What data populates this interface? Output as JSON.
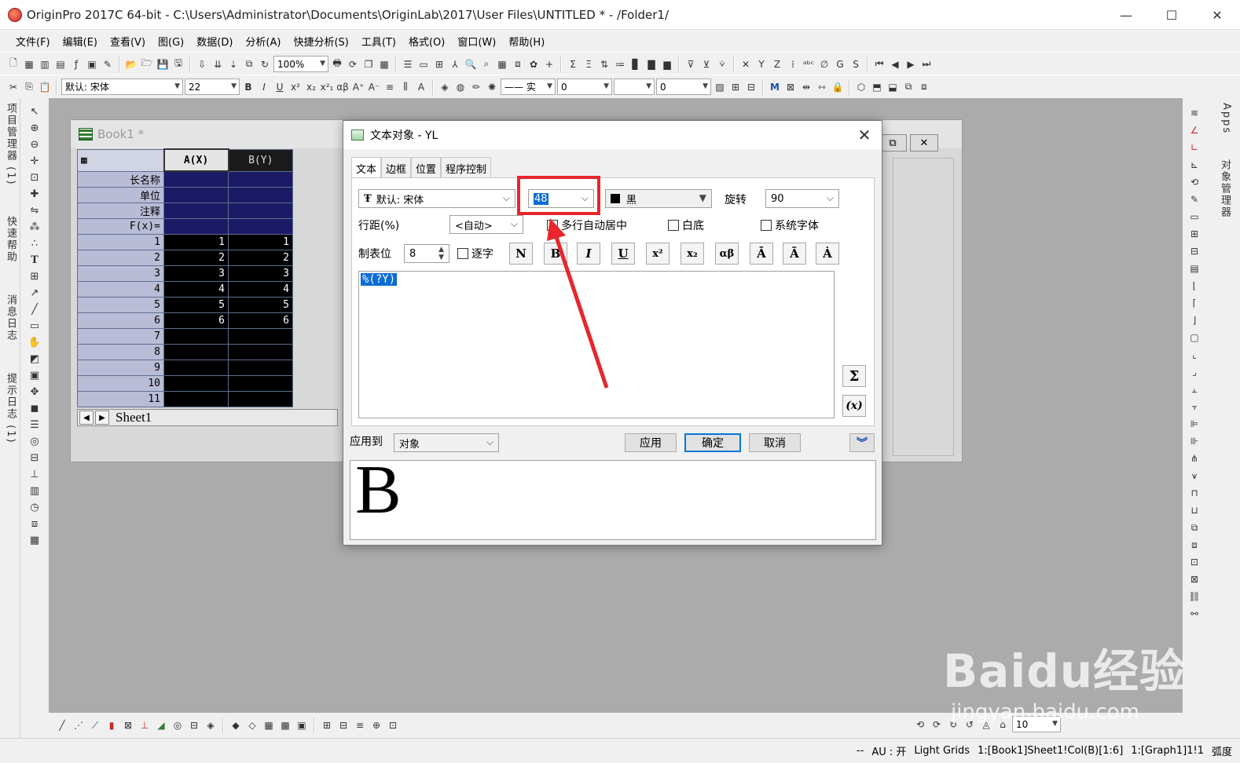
{
  "window": {
    "title": "OriginPro 2017C 64-bit - C:\\Users\\Administrator\\Documents\\OriginLab\\2017\\User Files\\UNTITLED * - /Folder1/",
    "minimize": "—",
    "maximize": "☐",
    "close": "✕"
  },
  "menu": [
    "文件(F)",
    "编辑(E)",
    "查看(V)",
    "图(G)",
    "数据(D)",
    "分析(A)",
    "快捷分析(S)",
    "工具(T)",
    "格式(O)",
    "窗口(W)",
    "帮助(H)"
  ],
  "toolbar1": {
    "zoom": "100%"
  },
  "toolbar2": {
    "font": "默认: 宋体",
    "font_size": "22",
    "line_style": "—— 实",
    "line_width": "0",
    "pattern_width": "0"
  },
  "left_dock_tabs": [
    "项目管理器 (1)",
    "快速帮助",
    "消息日志",
    "提示日志 (1)"
  ],
  "right_dock_tabs": [
    "Apps",
    "对象管理器"
  ],
  "workbook": {
    "title": "Book1 *",
    "columns": [
      {
        "label": "A(X)"
      },
      {
        "label": "B(Y)"
      }
    ],
    "meta_rows": [
      "长名称",
      "单位",
      "注释",
      "F(x)="
    ],
    "row_numbers": [
      "1",
      "2",
      "3",
      "4",
      "5",
      "6",
      "7",
      "8",
      "9",
      "10",
      "11"
    ],
    "col_a": [
      "1",
      "2",
      "3",
      "4",
      "5",
      "6",
      "",
      "",
      "",
      "",
      ""
    ],
    "col_b": [
      "1",
      "2",
      "3",
      "4",
      "5",
      "6",
      "",
      "",
      "",
      "",
      ""
    ],
    "sheet_tab": "Sheet1"
  },
  "dialog": {
    "title": "文本对象 - YL",
    "tabs": [
      "文本",
      "边框",
      "位置",
      "程序控制"
    ],
    "active_tab": "文本",
    "font": "默认: 宋体",
    "font_size": "48",
    "color": "黑",
    "rotate_label": "旋转",
    "rotate_value": "90",
    "line_spacing_label": "行距(%)",
    "line_spacing_value": "<自动>",
    "multiline_center": "多行自动居中",
    "white_bg": "白底",
    "system_font": "系统字体",
    "tab_stop_label": "制表位",
    "tab_stop_value": "8",
    "per_char": "逐字",
    "format_buttons": [
      "N",
      "B",
      "I",
      "U",
      "x²",
      "x₂",
      "αβ",
      "Ā",
      "Ã",
      "Ȧ"
    ],
    "text_content": "%(?Y)",
    "sigma_button": "Σ",
    "x_button": "(x)",
    "apply_to_label": "应用到",
    "apply_to_value": "对象",
    "apply_button": "应用",
    "ok_button": "确定",
    "cancel_button": "取消",
    "expand_button": "︾",
    "preview_text": "B"
  },
  "status": {
    "left": "--",
    "au": "AU : 开",
    "grids": "Light Grids",
    "range": "1:[Book1]Sheet1!Col(B)[1:6]",
    "graph": "1:[Graph1]1!1",
    "unit": "弧度"
  },
  "bottom_toolbar": {
    "value": "10"
  },
  "watermark": {
    "brand": "Baidu经验",
    "url": "jingyan.baidu.com"
  },
  "colors": {
    "highlight_box": "#e8262b",
    "arrow": "#e8262b",
    "workspace": "#ababab",
    "selection": "#0a6cd6"
  }
}
